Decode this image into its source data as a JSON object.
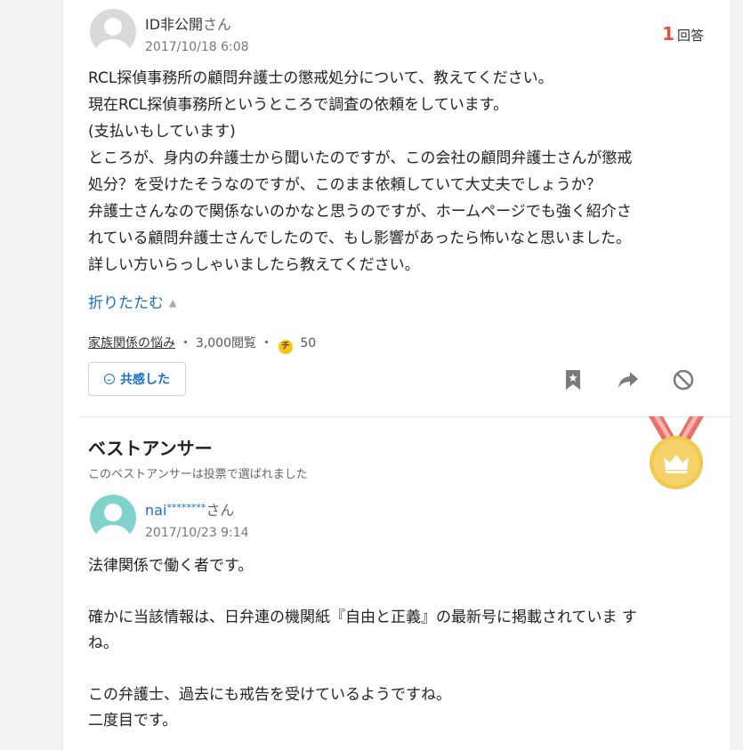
{
  "question": {
    "user_name": "ID非公開",
    "user_suffix": "さん",
    "timestamp": "2017/10/18 6:08",
    "answer_count": "1",
    "answer_count_label": "回答",
    "body_lines": [
      "RCL探偵事務所の顧問弁護士の懲戒処分について、教えてください。",
      "現在RCL探偵事務所というところで調査の依頼をしています。",
      "(支払いもしています)",
      "ところが、身内の弁護士から聞いたのですが、この会社の顧問弁護士さんが懲戒",
      "処分？を受けたそうなのですが、このまま依頼していて大丈夫でしょうか？",
      "弁護士さんなので関係ないのかなと思うのですが、ホームページでも強く紹介さ",
      "れている顧問弁護士さんでしたので、もし影響があったら怖いなと思いました。",
      "詳しい方いらっしゃいましたら教えてください。"
    ],
    "collapse_label": "折りたたむ",
    "category": "家族関係の悩み",
    "separator": "・",
    "views": "3,000閲覧",
    "coin_symbol": "チ",
    "coins": "50",
    "empathy_label": "共感した"
  },
  "best_answer": {
    "title": "ベストアンサー",
    "note": "このベストアンサーは投票で選ばれました",
    "user_name": "nai",
    "user_mask": "********",
    "user_suffix": "さん",
    "timestamp": "2017/10/23 9:14",
    "body_lines": [
      "法律関係で働く者です。",
      "",
      "確かに当該情報は、日弁連の機関紙『自由と正義』の最新号に掲載されていま す",
      "ね。",
      "",
      "この弁護士、過去にも戒告を受けているようですね。",
      "二度目です。"
    ]
  },
  "colors": {
    "accent_link": "#1a6fc9",
    "answer_count": "#e0503a",
    "medal_gold": "#f2c94c",
    "medal_ribbon": "#e8706a"
  }
}
